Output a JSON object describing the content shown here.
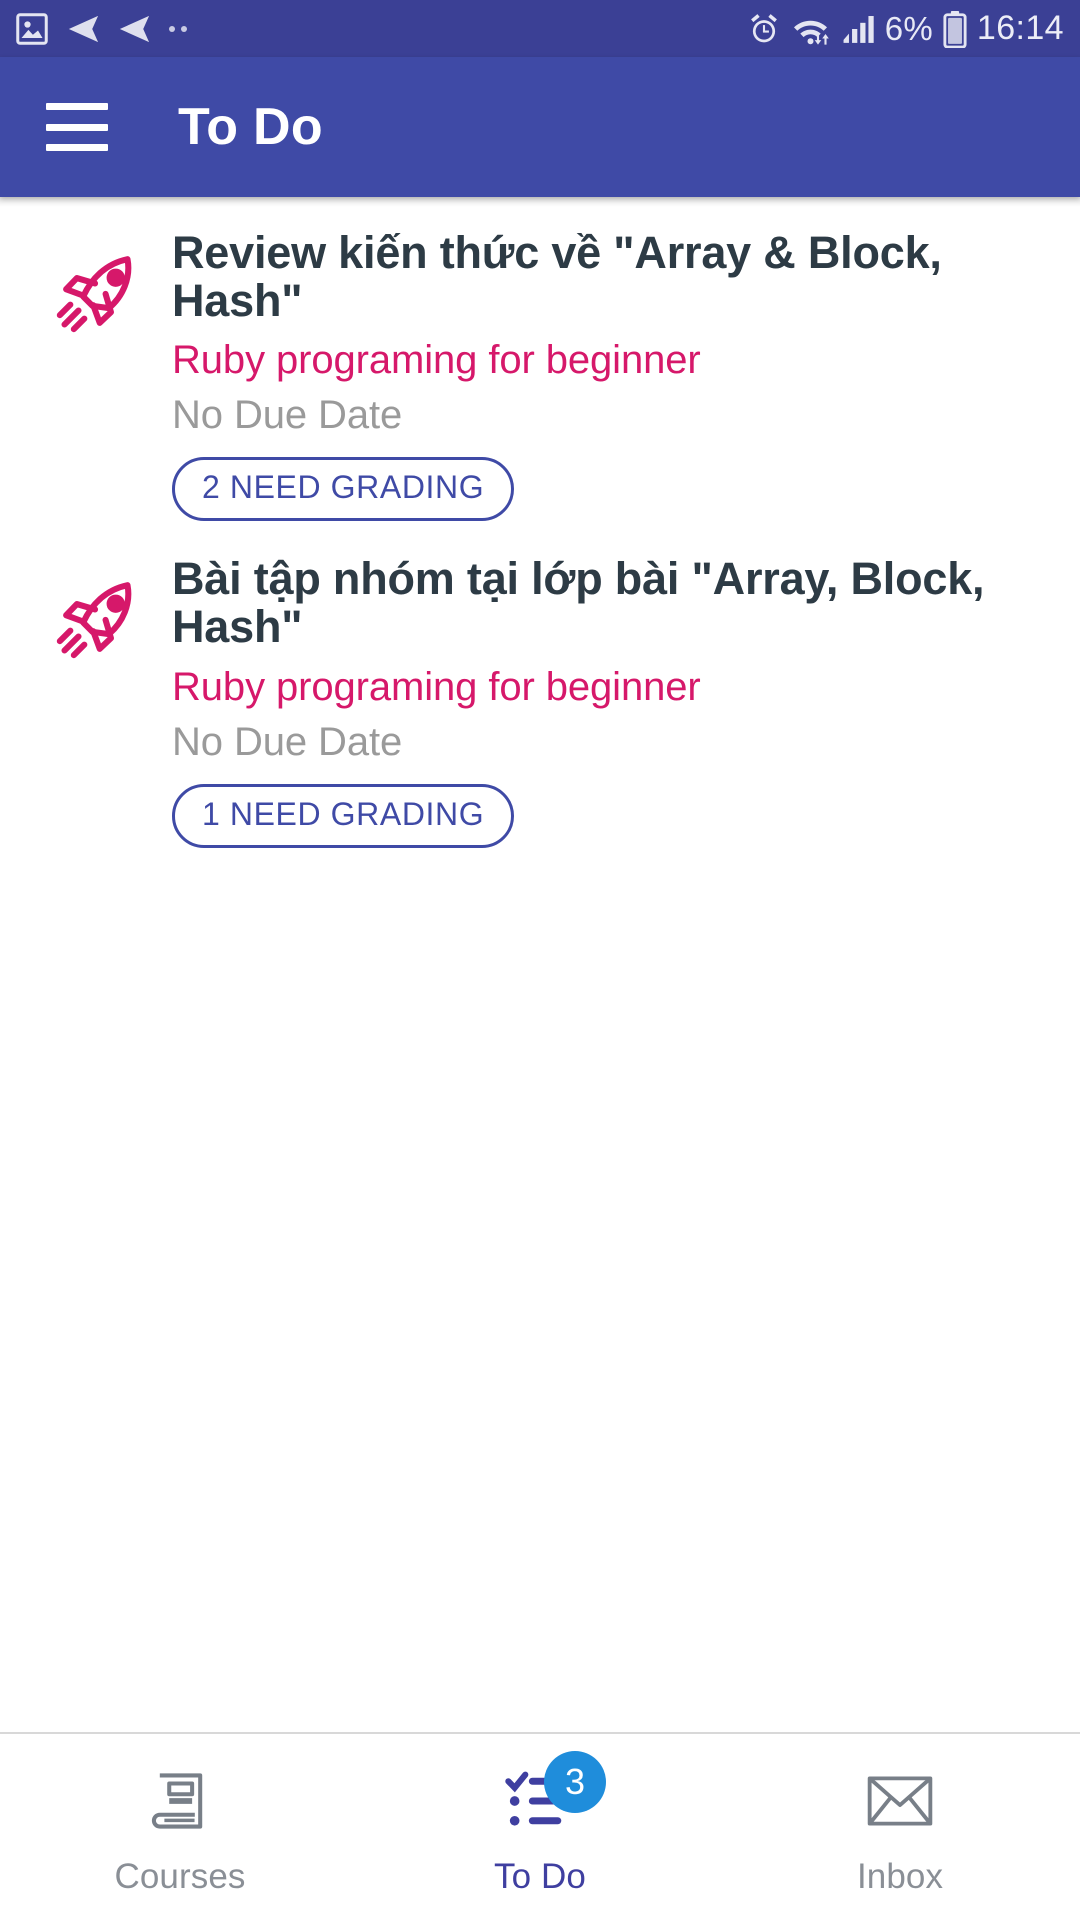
{
  "status_bar": {
    "battery_percent": "6%",
    "clock": "16:14",
    "icons": [
      "image-icon",
      "rewind-icon",
      "rewind-icon",
      "more-dots-icon",
      "alarm-icon",
      "wifi-icon",
      "signal-icon",
      "battery-icon"
    ]
  },
  "app_bar": {
    "menu_icon": "hamburger-menu-icon",
    "title": "To Do"
  },
  "colors": {
    "app_bar": "#3f4aa6",
    "status_bar": "#3b4095",
    "course_text": "#d6186a",
    "rocket_icon": "#d6186a",
    "pill_border": "#3f4aa6",
    "badge": "#1f8ddb",
    "title_text": "#2d3b45",
    "muted_text": "#9a9a9a"
  },
  "todo_list": {
    "items": [
      {
        "icon": "rocket-icon",
        "title": "Review kiến thức về \"Array & Block, Hash\"",
        "course": "Ruby programing for beginner",
        "due": "No Due Date",
        "badge": "2 NEED GRADING"
      },
      {
        "icon": "rocket-icon",
        "title": "Bài tập nhóm tại lớp bài \"Array, Block, Hash\"",
        "course": "Ruby programing for beginner",
        "due": "No Due Date",
        "badge": "1 NEED GRADING"
      }
    ]
  },
  "bottom_nav": {
    "items": [
      {
        "label": "Courses",
        "icon": "book-icon",
        "active": false,
        "badge": ""
      },
      {
        "label": "To Do",
        "icon": "checklist-icon",
        "active": true,
        "badge": "3"
      },
      {
        "label": "Inbox",
        "icon": "envelope-icon",
        "active": false,
        "badge": ""
      }
    ]
  }
}
